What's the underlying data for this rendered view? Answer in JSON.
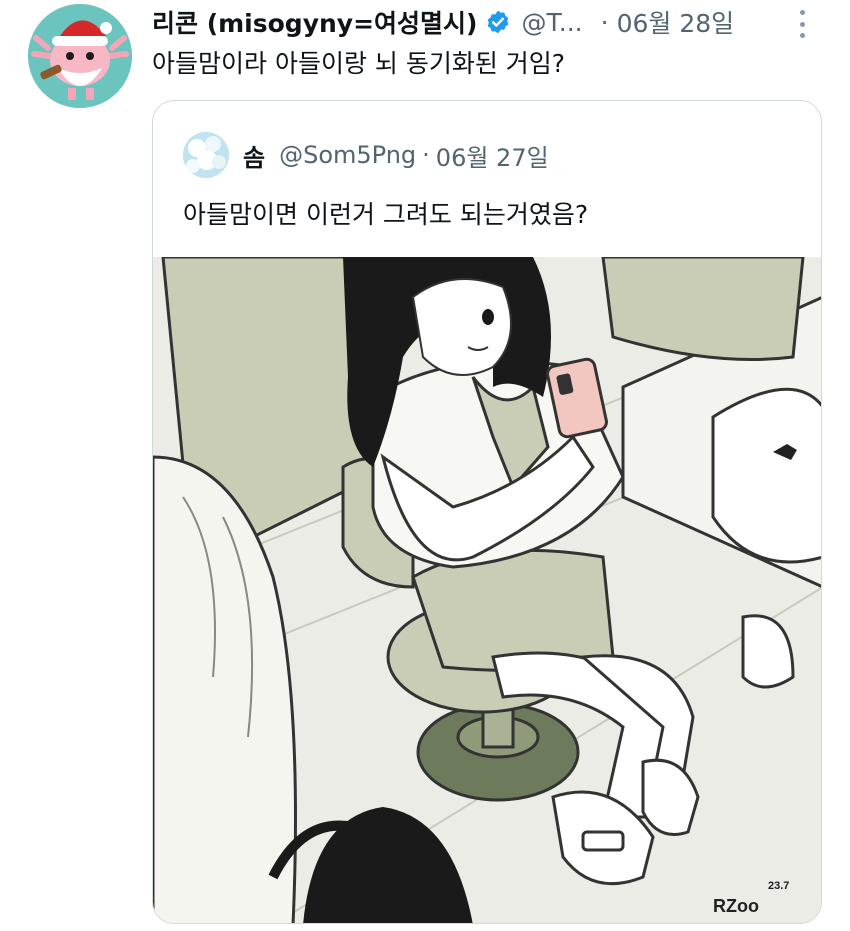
{
  "tweet": {
    "author": {
      "display_name": "리콘 (misogyny=여성멸시)",
      "handle": "@T...",
      "verified": true,
      "avatar_icon": "axolotl-santa-avatar"
    },
    "separator": "·",
    "date": "06월 28일",
    "text": "아들맘이라 아들이랑 뇌 동기화된 거임?",
    "more_icon": "more-vertical-icon"
  },
  "quoted": {
    "author": {
      "display_name": "솜",
      "handle": "@Som5Png",
      "avatar_icon": "cotton-avatar"
    },
    "separator": "·",
    "date": "06월 27일",
    "text": "아들맘이면 이런거 그려도 되는거였음?",
    "media": {
      "kind": "illustration",
      "signature": "RZoo 23.7"
    }
  },
  "colors": {
    "text_primary": "#0f1419",
    "text_secondary": "#536471",
    "verified_blue": "#1d9bf0",
    "card_border": "#cfd9de",
    "illustration_green": "#c9cdb6",
    "illustration_dark": "#6e7a5c"
  }
}
